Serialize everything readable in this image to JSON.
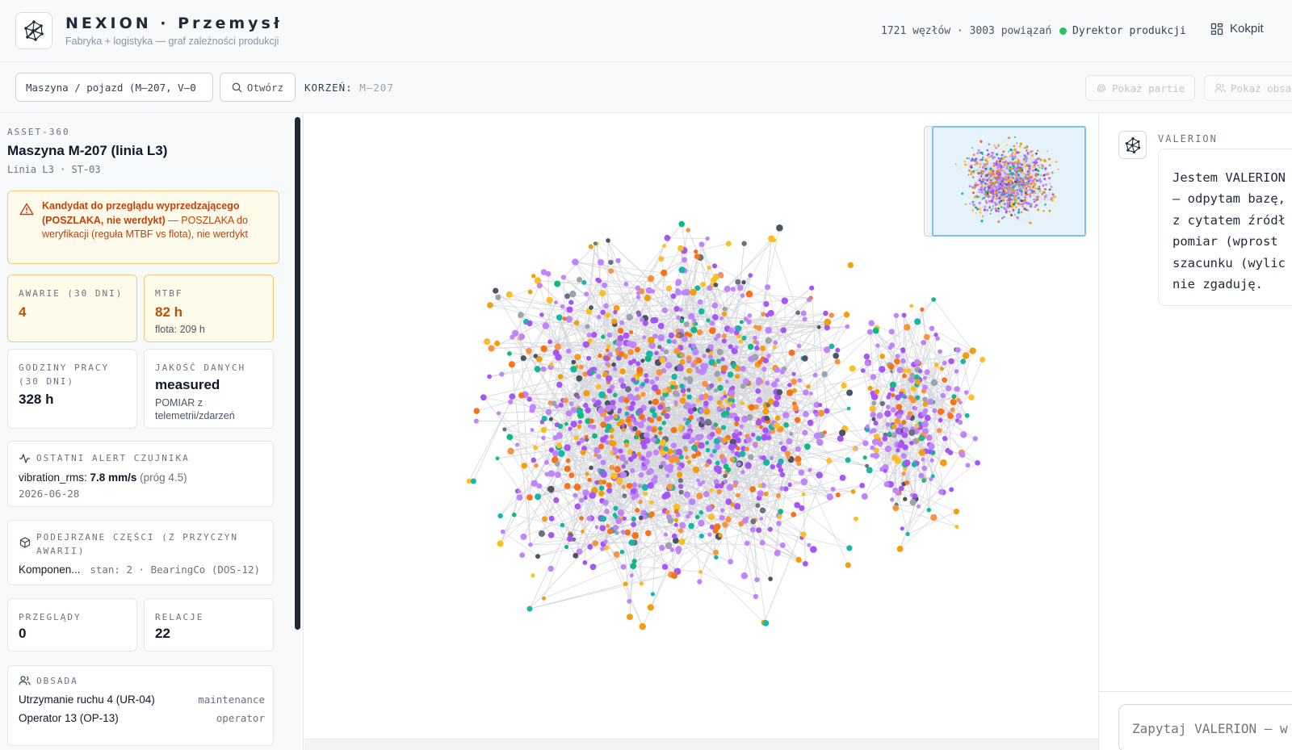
{
  "header": {
    "title": "NEXION · Przemysł",
    "subtitle": "Fabryka + logistyka — graf zależności produkcji",
    "stats": "1721 węzłów · 3003 powiązań",
    "role": "Dyrektor produkcji",
    "kokpit_label": "Kokpit",
    "role_color": "#22c55e"
  },
  "toolbar": {
    "search_value": "Maszyna / pojazd (M–207, V–0",
    "open_label": "Otwórz",
    "root_label": "KORZEŃ:",
    "root_value": "M–207",
    "show_batches_label": "Pokaż partie",
    "show_staff_label": "Pokaż obsadę"
  },
  "asset": {
    "id": "ASSET-360",
    "name": "Maszyna M-207 (linia L3)",
    "location": "Linia L3 · ST-03",
    "warning": {
      "bold": "Kandydat do przeglądu wyprzedzającego (POSZLAKA, nie werdykt)",
      "rest": " — POSZLAKA do weryfikacji (reguła MTBF vs flota), nie werdykt"
    },
    "failures": {
      "label": "AWARIE (30 DNI)",
      "value": "4"
    },
    "mtbf": {
      "label": "MTBF",
      "value": "82 h",
      "sub": "flota: 209 h"
    },
    "hours": {
      "label": "GODZINY PRACY (30 DNI)",
      "value": "328 h"
    },
    "quality": {
      "label": "JAKOŚĆ DANYCH",
      "value": "measured",
      "sub": "POMIAR z telemetrii/zdarzeń"
    },
    "alert": {
      "label": "OSTATNI ALERT CZUJNIKA",
      "metric": "vibration_rms:",
      "value": "7.8 mm/s",
      "threshold": "(próg 4.5)",
      "date": "2026-06-28"
    },
    "parts": {
      "label": "PODEJRZANE CZĘŚCI (Z PRZYCZYN AWARII)",
      "name": "Komponen...",
      "detail": "stan: 2 · BearingCo (DOS-12)"
    },
    "inspections": {
      "label": "PRZEGLĄDY",
      "value": "0"
    },
    "relations": {
      "label": "RELACJE",
      "value": "22"
    },
    "staff": {
      "label": "OBSADA",
      "rows": [
        {
          "name": "Utrzymanie ruchu 4 (UR-04)",
          "role": "maintenance"
        },
        {
          "name": "Operator 13 (OP-13)",
          "role": "operator"
        }
      ]
    }
  },
  "graph": {
    "node_colors": [
      "#c084fc",
      "#a855f7",
      "#fbbf24",
      "#f59e0b",
      "#fb923c",
      "#f97316",
      "#14b8a6",
      "#10b981",
      "#9ca3af",
      "#6b7280",
      "#4b5563"
    ],
    "edge_color": "#d4d6db"
  },
  "assistant": {
    "name": "VALERION",
    "message_lines": [
      "Jestem VALERION",
      "— odpytam bazę,",
      "z cytatem źródł",
      "pomiar (wprost",
      "szacunku (wylic",
      "nie zgaduję."
    ],
    "input_placeholder": "Zapytaj VALERION — w"
  }
}
